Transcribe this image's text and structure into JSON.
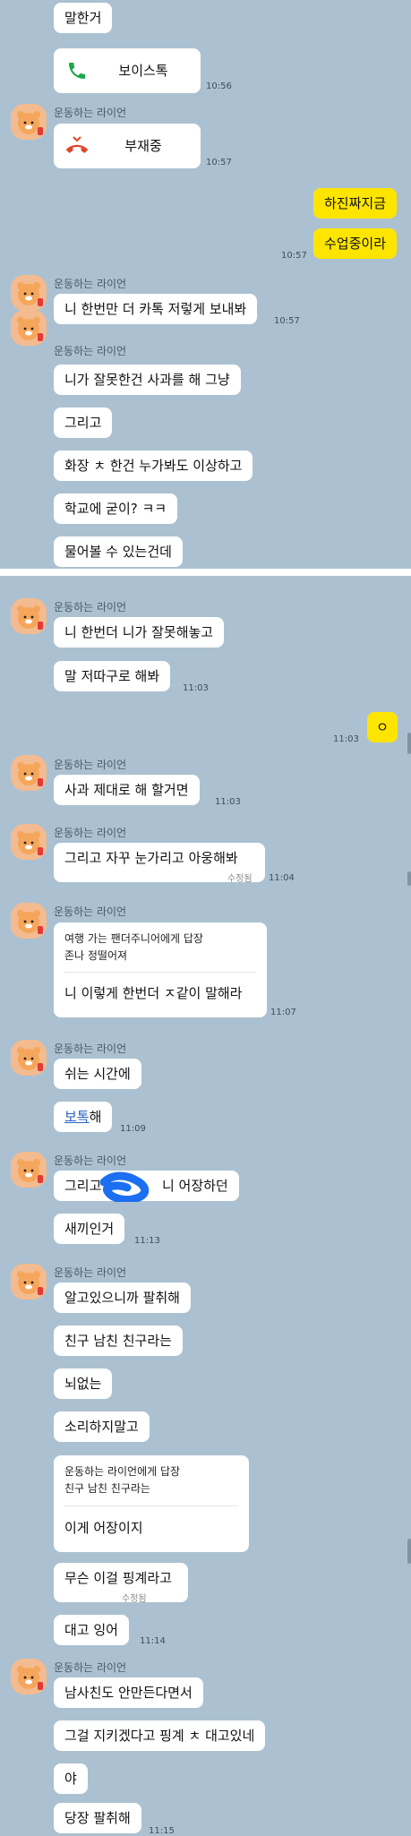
{
  "sender_name": "운동하는 라이언",
  "section1": {
    "msg_top": "말한거",
    "voice_call": {
      "label": "보이스톡",
      "time": "10:56"
    },
    "missed_call": {
      "label": "부재중",
      "time": "10:57"
    },
    "me_1": "하진짜지금",
    "me_2": "수업중이라",
    "me_time": "10:57",
    "r1": "니 한번만 더 카톡 저렇게 보내봐",
    "r1_time": "10:57",
    "r2": [
      "니가 잘못한건 사과를 해 그냥",
      "그리고",
      "화장 ㅊ 한건 누가봐도 이상하고",
      "학교에 굳이? ㅋㅋ",
      "물어볼 수 있는건데"
    ]
  },
  "section2": {
    "g1": [
      "니 한번더 니가 잘못해놓고",
      "말 저따구로 해봐"
    ],
    "g1_time": "11:03",
    "me_o": "ㅇ",
    "me_o_time": "11:03",
    "g2": "사과 제대로 해 할거면",
    "g2_time": "11:03",
    "g3": "그리고 자꾸 눈가리고 아웅해봐",
    "g3_edited": "수정됨",
    "g3_time": "11:04",
    "g4_reply_header": [
      "여행 가는 팬더주니어에게 답장",
      "존나 정떨어져"
    ],
    "g4_msg": "니 이렇게 한번더 ㅈ같이 말해라",
    "g4_time": "11:07",
    "g5": "쉬는 시간에",
    "g5_link": "보톡",
    "g5_suffix": "해",
    "g5_time": "11:09",
    "g6_a": "그리고",
    "g6_b": "니 어장하던",
    "g6_c": "새끼인거",
    "g6_time": "11:13",
    "g7": [
      "알고있으니까 팔취해",
      "친구 남친 친구라는",
      "뇌없는",
      "소리하지말고"
    ],
    "g7_reply_header": [
      "운동하는 라이언에게 답장",
      "친구 남친 친구라는"
    ],
    "g7_reply_msg": "이게 어장이지",
    "g7_b": "무슨 이걸 핑계라고",
    "g7_edited": "수정됨",
    "g7_c": "대고 잉어",
    "g7_time": "11:14",
    "g8": [
      "남사친도 안만든다면서",
      "그걸 지키겠다고 핑계 ㅊ 대고있네",
      "야",
      "당장 팔취해"
    ],
    "g8_time": "11:15"
  },
  "colors": {
    "bg": "#abc1d1",
    "mine": "#fee500",
    "theirs": "#ffffff",
    "accept": "#1aa84b",
    "missed": "#e1462b"
  },
  "icons": [
    "lion-avatar-icon",
    "phone-icon",
    "missed-call-icon"
  ]
}
